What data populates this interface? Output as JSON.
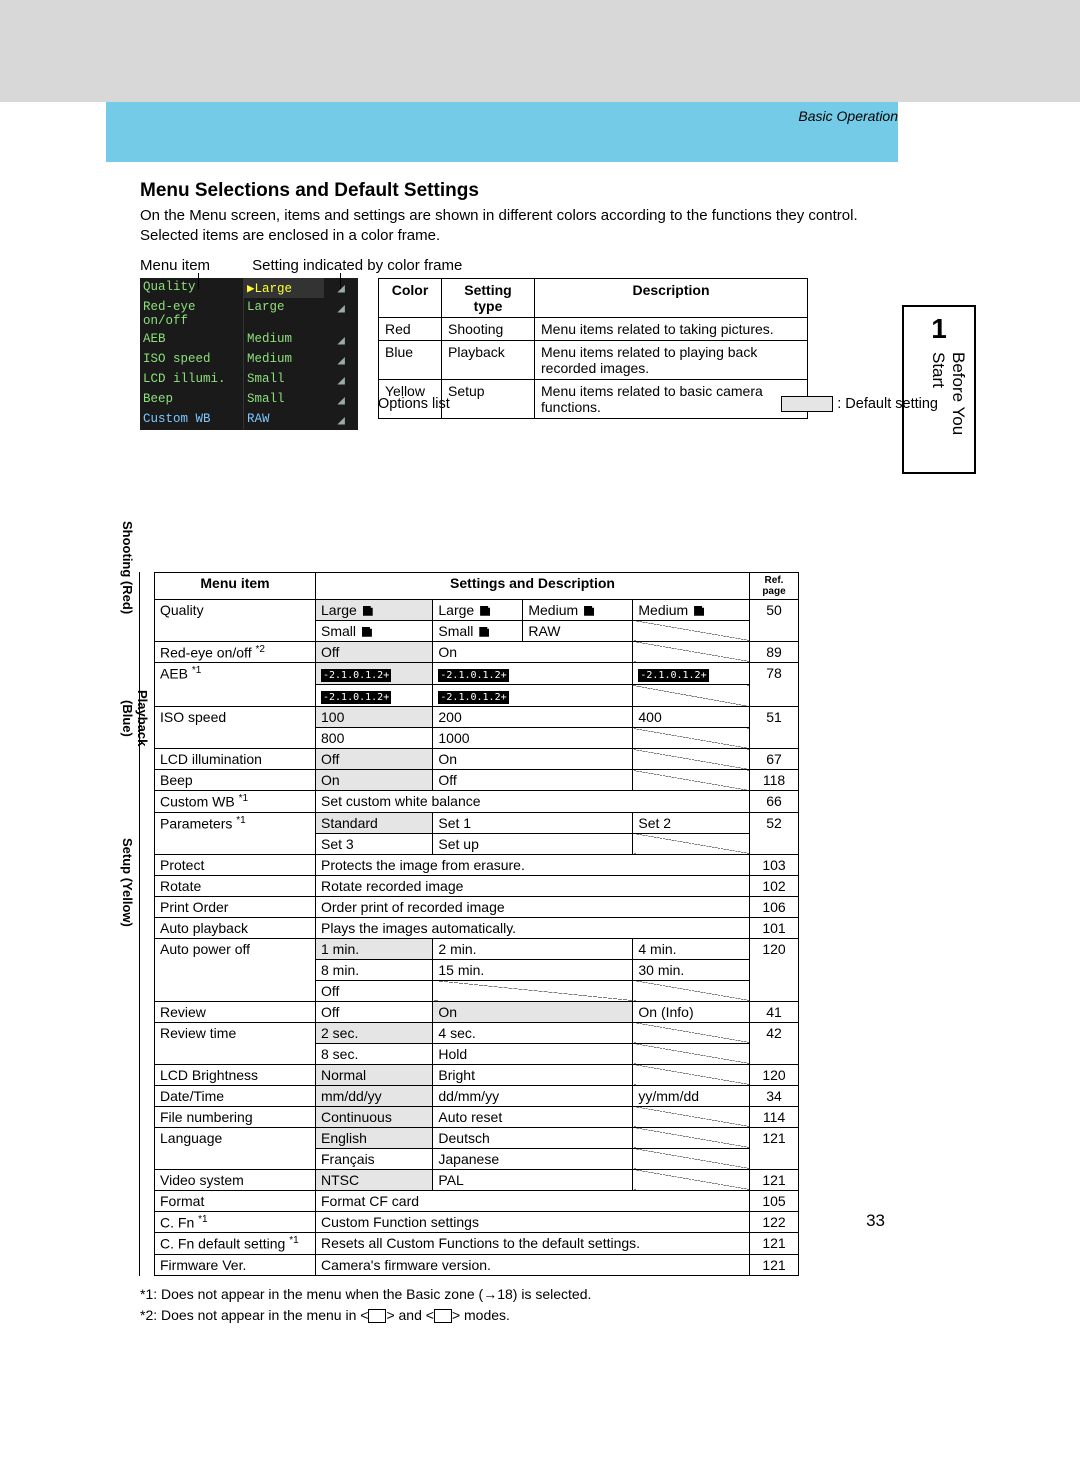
{
  "runningHead": "Basic Operation",
  "title": "Menu Selections and Default Settings",
  "intro": "On the Menu screen, items and settings are shown in different colors according to the functions they control. Selected items are enclosed in a color frame.",
  "annotate": {
    "menuItem": "Menu item",
    "setting": "Setting indicated by color frame"
  },
  "cameraRows": [
    {
      "c1": "Quality",
      "c2": "▶Large",
      "hl": true
    },
    {
      "c1": "Red-eye on/off",
      "c2": "Large"
    },
    {
      "c1": "AEB",
      "c2": "Medium"
    },
    {
      "c1": "ISO speed",
      "c2": "Medium"
    },
    {
      "c1": "LCD illumi.",
      "c2": "Small"
    },
    {
      "c1": "Beep",
      "c2": "Small"
    },
    {
      "c1": "Custom WB",
      "c2": "RAW",
      "blue": true
    }
  ],
  "colorTable": {
    "head": [
      "Color",
      "Setting type",
      "Description"
    ],
    "rows": [
      [
        "Red",
        "Shooting",
        "Menu items related to taking pictures."
      ],
      [
        "Blue",
        "Playback",
        "Menu items related to playing back recorded images."
      ],
      [
        "Yellow",
        "Setup",
        "Menu items related to basic camera functions."
      ]
    ]
  },
  "optsLabel": "Options list",
  "defaultLabel": ": Default setting",
  "mainHead": {
    "item": "Menu item",
    "settings": "Settings and Description",
    "ref": "Ref. page"
  },
  "sections": {
    "shooting": "Shooting (Red)",
    "playback": "Playback (Blue)",
    "setup": "Setup (Yellow)"
  },
  "aebGlyph": "-2.1.0.1.2+",
  "rows": {
    "quality": {
      "item": "Quality",
      "ref": "50",
      "cells": [
        [
          "Large",
          "Large",
          "Medium",
          "Medium"
        ],
        [
          "Small",
          "Small",
          "RAW",
          ""
        ]
      ]
    },
    "redeye": {
      "item": "Red-eye on/off *2",
      "ref": "89",
      "cells": [
        "Off",
        "On",
        "",
        ""
      ]
    },
    "aeb": {
      "item": "AEB *1",
      "ref": "78"
    },
    "iso": {
      "item": "ISO speed",
      "ref": "51",
      "cells": [
        [
          "100",
          "200",
          "400"
        ],
        [
          "800",
          "1000",
          ""
        ]
      ]
    },
    "lcd": {
      "item": "LCD illumination",
      "ref": "67",
      "cells": [
        "Off",
        "On",
        "",
        ""
      ]
    },
    "beep": {
      "item": "Beep",
      "ref": "118",
      "cells": [
        "On",
        "Off",
        "",
        ""
      ]
    },
    "cwb": {
      "item": "Custom WB *1",
      "ref": "66",
      "desc": "Set custom white balance"
    },
    "param": {
      "item": "Parameters *1",
      "ref": "52",
      "cells": [
        [
          "Standard",
          "Set 1",
          "Set 2"
        ],
        [
          "Set 3",
          "Set up",
          ""
        ]
      ]
    },
    "protect": {
      "item": "Protect",
      "ref": "103",
      "desc": "Protects the image from erasure."
    },
    "rotate": {
      "item": "Rotate",
      "ref": "102",
      "desc": "Rotate recorded image"
    },
    "print": {
      "item": "Print Order",
      "ref": "106",
      "desc": "Order print of recorded image"
    },
    "auto": {
      "item": "Auto playback",
      "ref": "101",
      "desc": "Plays the images automatically."
    },
    "power": {
      "item": "Auto power off",
      "ref": "120",
      "cells": [
        [
          "1 min.",
          "2 min.",
          "4 min."
        ],
        [
          "8 min.",
          "15 min.",
          "30 min."
        ],
        [
          "Off",
          "",
          ""
        ]
      ]
    },
    "review": {
      "item": "Review",
      "ref": "41",
      "cells": [
        "Off",
        "On",
        "On (Info)"
      ]
    },
    "rtime": {
      "item": "Review time",
      "ref": "42",
      "cells": [
        [
          "2 sec.",
          "4 sec.",
          ""
        ],
        [
          "8 sec.",
          "Hold",
          ""
        ]
      ]
    },
    "bright": {
      "item": "LCD Brightness",
      "ref": "120",
      "cells": [
        "Normal",
        "Bright",
        "",
        ""
      ]
    },
    "date": {
      "item": "Date/Time",
      "ref": "34",
      "cells": [
        "mm/dd/yy",
        "dd/mm/yy",
        "yy/mm/dd"
      ]
    },
    "file": {
      "item": "File numbering",
      "ref": "114",
      "cells": [
        "Continuous",
        "Auto reset",
        "",
        ""
      ]
    },
    "lang": {
      "item": "Language",
      "ref": "121",
      "cells": [
        [
          "English",
          "Deutsch"
        ],
        [
          "Français",
          "Japanese"
        ]
      ]
    },
    "video": {
      "item": "Video system",
      "ref": "121",
      "cells": [
        "NTSC",
        "PAL",
        "",
        ""
      ]
    },
    "format": {
      "item": "Format",
      "ref": "105",
      "desc": "Format CF card"
    },
    "cfn": {
      "item": "C. Fn *1",
      "ref": "122",
      "desc": "Custom Function settings"
    },
    "cfnd": {
      "item": "C. Fn default setting *1",
      "ref": "121",
      "desc": "Resets all Custom Functions to the default settings."
    },
    "fw": {
      "item": "Firmware Ver.",
      "ref": "121",
      "desc": "Camera's firmware version."
    }
  },
  "footnotes": [
    "*1: Does not appear in the menu when the Basic zone (→18) is selected.",
    "*2: Does not appear in the menu in < ICON > and < ICON > modes."
  ],
  "pageNum": "33",
  "sideTab": {
    "num": "1",
    "txt": "Before You Start"
  }
}
